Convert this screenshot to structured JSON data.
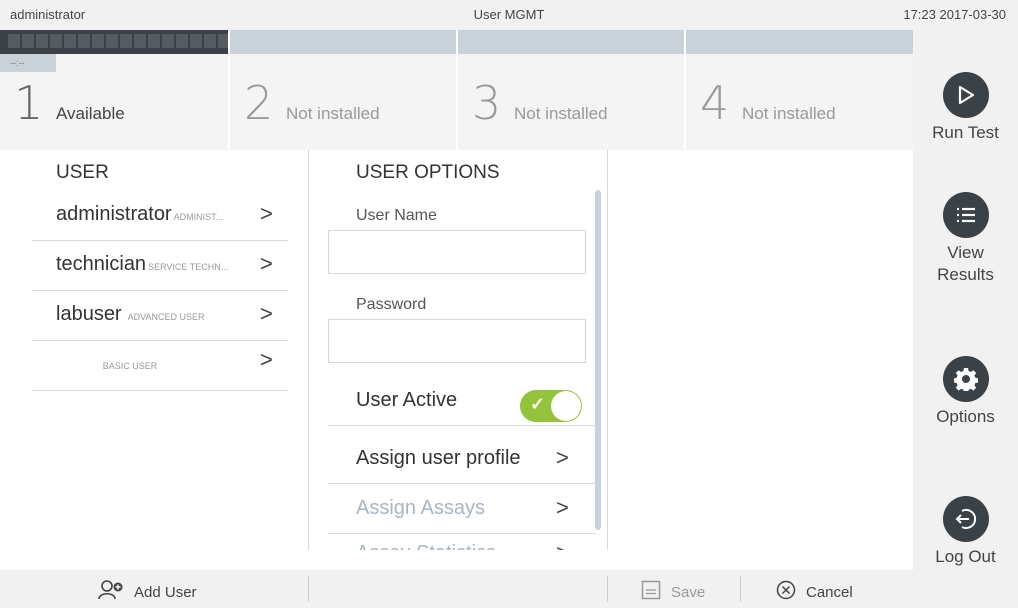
{
  "topbar": {
    "user": "administrator",
    "title": "User MGMT",
    "datetime": "17:23 2017-03-30"
  },
  "modules": [
    {
      "num": "1",
      "label": "Available",
      "badge": "--:--"
    },
    {
      "num": "2",
      "label": "Not installed"
    },
    {
      "num": "3",
      "label": "Not installed"
    },
    {
      "num": "4",
      "label": "Not installed"
    }
  ],
  "sidebar": {
    "run_test": "Run Test",
    "view_results_1": "View",
    "view_results_2": "Results",
    "options": "Options",
    "log_out": "Log Out"
  },
  "users": {
    "title": "USER",
    "rows": [
      {
        "name": "administrator",
        "role": "ADMINIST..."
      },
      {
        "name": "technician",
        "role": "SERVICE TECHN..."
      },
      {
        "name": "labuser",
        "role": "ADVANCED USER"
      },
      {
        "name": "",
        "role": "BASIC USER"
      }
    ]
  },
  "user_options": {
    "title": "USER OPTIONS",
    "username_label": "User Name",
    "username_value": "",
    "password_label": "Password",
    "password_value": "",
    "user_active": "User Active",
    "user_active_state": true,
    "assign_profile": "Assign user profile",
    "assign_assays": "Assign Assays",
    "assay_statistics": "Assay Statistics"
  },
  "bottombar": {
    "add_user": "Add User",
    "save": "Save",
    "cancel": "Cancel"
  },
  "colors": {
    "accent_green": "#93c33a",
    "dark": "#3a4147",
    "dim_text": "#a8b5c4"
  }
}
